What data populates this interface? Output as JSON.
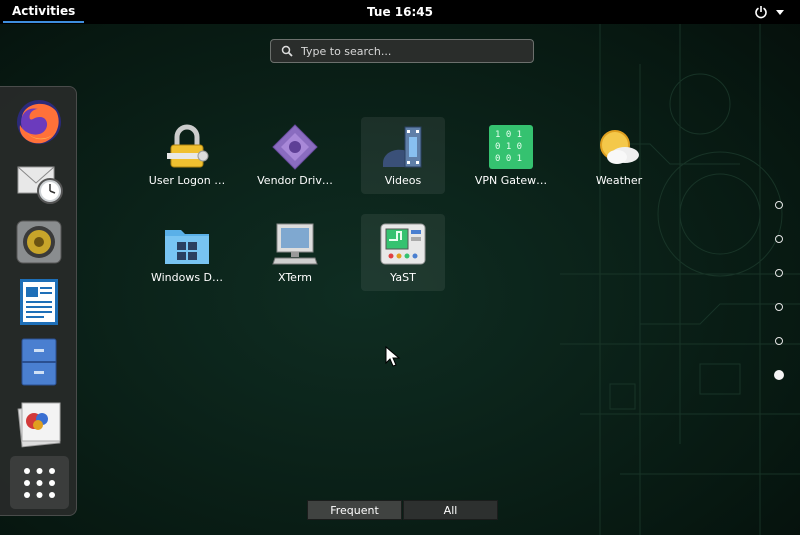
{
  "topbar": {
    "activities_label": "Activities",
    "clock": "Tue 16:45",
    "power_icon": "power-icon",
    "menu_icon": "caret-down-icon"
  },
  "search": {
    "placeholder": "Type to search..."
  },
  "dash": {
    "items": [
      {
        "name": "Firefox",
        "icon": "firefox-icon"
      },
      {
        "name": "Evolution",
        "icon": "mail-clock-icon"
      },
      {
        "name": "Rhythmbox",
        "icon": "speaker-icon"
      },
      {
        "name": "LibreOffice Writer",
        "icon": "document-icon"
      },
      {
        "name": "Files",
        "icon": "file-cabinet-icon"
      },
      {
        "name": "Image Viewer",
        "icon": "photos-icon"
      }
    ],
    "show_apps_icon": "app-grid-icon"
  },
  "apps": [
    {
      "label": "User Logon …",
      "icon": "lock-key-icon"
    },
    {
      "label": "Vendor Driv…",
      "icon": "driver-diamond-icon"
    },
    {
      "label": "Videos",
      "icon": "film-icon"
    },
    {
      "label": "VPN Gatew…",
      "icon": "binary-icon"
    },
    {
      "label": "Weather",
      "icon": "weather-icon"
    },
    {
      "label": "Windows D…",
      "icon": "windows-folder-icon"
    },
    {
      "label": "XTerm",
      "icon": "monitor-icon"
    },
    {
      "label": "YaST",
      "icon": "yast-icon"
    }
  ],
  "pages": {
    "count": 6,
    "active": 6
  },
  "tabs": {
    "frequent": "Frequent",
    "all": "All",
    "selected": "Frequent"
  },
  "colors": {
    "accent": "#3e8ede",
    "panel": "#000000",
    "background": "#0b2219"
  }
}
